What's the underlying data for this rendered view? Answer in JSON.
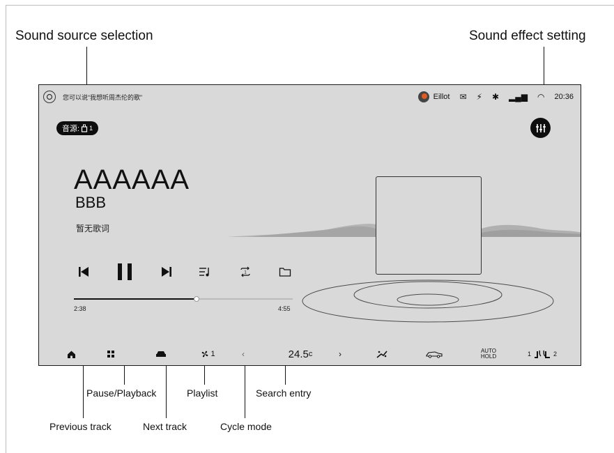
{
  "callouts": {
    "sound_source": "Sound source selection",
    "sound_effect": "Sound effect setting",
    "pause_playback": "Pause/Playback",
    "playlist": "Playlist",
    "search_entry": "Search entry",
    "previous_track": "Previous track",
    "next_track": "Next track",
    "cycle_mode": "Cycle mode"
  },
  "status_bar": {
    "voice_hint": "您可以说“我想听周杰伦的歌”",
    "user_name": "Eillot",
    "time": "20:36"
  },
  "source": {
    "label": "音源:",
    "device_number": "1"
  },
  "now_playing": {
    "title": "AAAAAA",
    "artist": "BBB",
    "lyrics": "暂无歌词",
    "elapsed": "2:38",
    "total": "4:55",
    "progress": 0.56
  },
  "climate": {
    "fan_level": "1",
    "temperature": "24.5",
    "temp_unit": "c",
    "auto_hold_line1": "AUTO",
    "auto_hold_line2": "HOLD",
    "seat_left": "1",
    "seat_right": "2"
  },
  "icons": {
    "voice": "voice-assistant-icon",
    "eq": "equalizer-icon",
    "prev": "previous-track-icon",
    "pause": "pause-icon",
    "next": "next-track-icon",
    "playlist": "playlist-icon",
    "cycle": "repeat-one-icon",
    "search": "folder-icon"
  },
  "colors": {
    "screen_bg": "#d9d9d9",
    "pill_bg": "#0e0e0e",
    "frame": "#1a1a1a"
  }
}
